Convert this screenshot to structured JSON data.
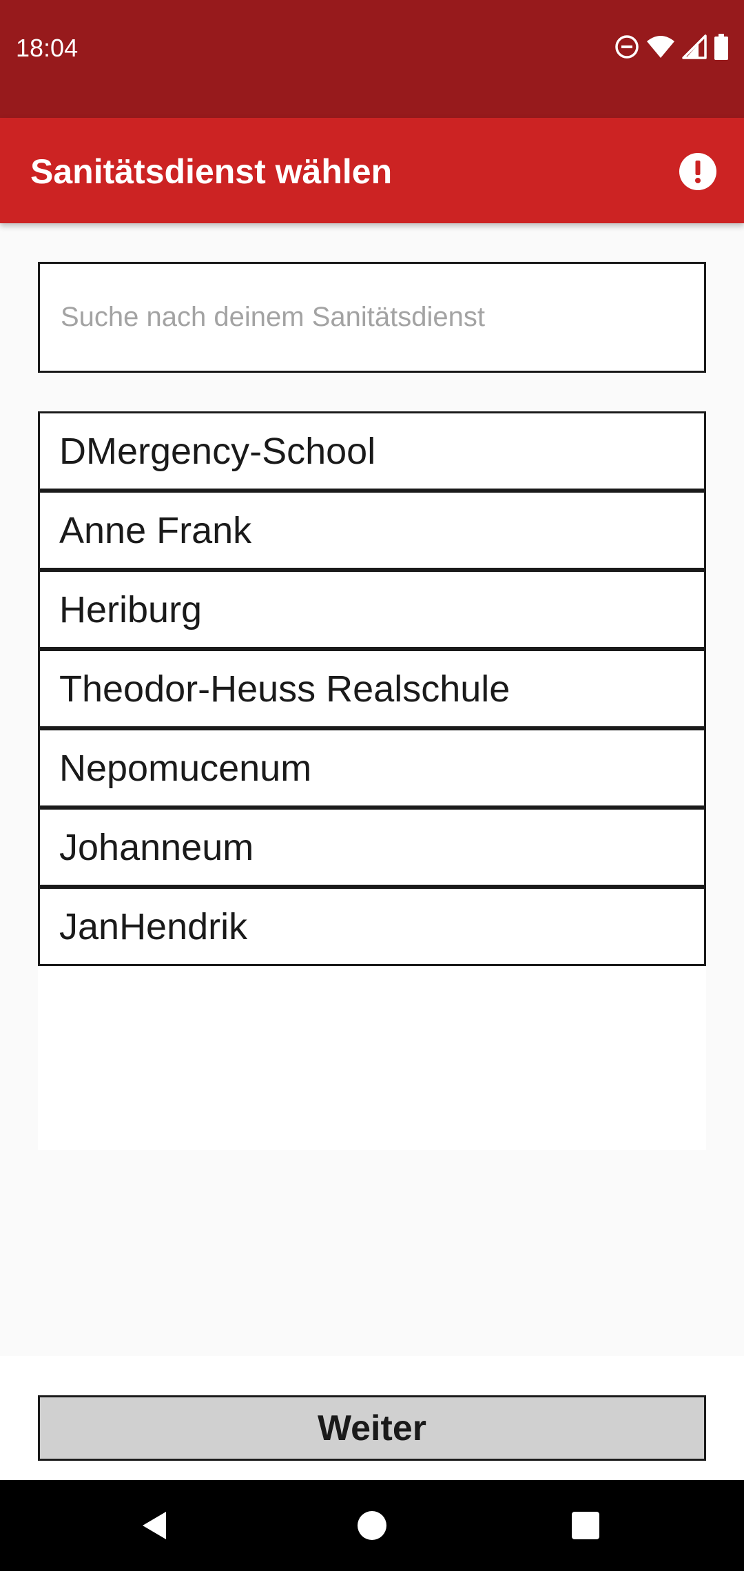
{
  "status_bar": {
    "time": "18:04",
    "icons": [
      "do-not-disturb-icon",
      "wifi-icon",
      "signal-icon",
      "battery-icon"
    ]
  },
  "app_bar": {
    "title": "Sanitätsdienst wählen",
    "action_icon": "alert-circle-icon"
  },
  "search": {
    "placeholder": "Suche nach deinem Sanitätsdienst",
    "value": ""
  },
  "list": {
    "items": [
      "DMergency-School",
      "Anne Frank",
      "Heriburg",
      "Theodor-Heuss Realschule",
      "Nepomucenum",
      "Johanneum",
      "JanHendrik"
    ]
  },
  "footer": {
    "next_label": "Weiter"
  },
  "nav": {
    "icons": [
      "back-icon",
      "home-icon",
      "recents-icon"
    ]
  },
  "colors": {
    "status_bar": "#971a1c",
    "app_bar": "#cc2323",
    "button": "#d0d0d0"
  }
}
